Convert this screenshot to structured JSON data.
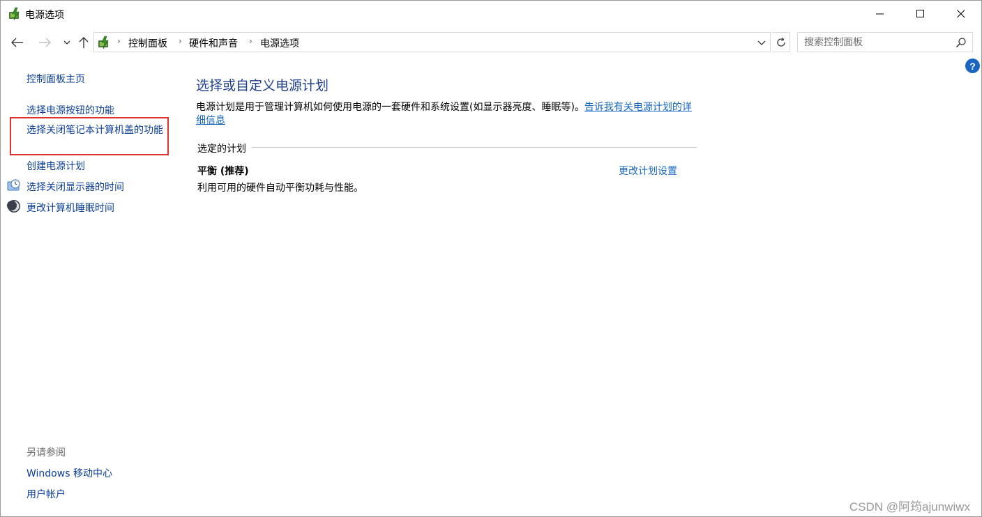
{
  "window": {
    "title": "电源选项",
    "icon": "power-options-icon"
  },
  "nav": {
    "breadcrumbs": [
      "控制面板",
      "硬件和声音",
      "电源选项"
    ],
    "search_placeholder": "搜索控制面板"
  },
  "help": {
    "label": "?"
  },
  "left_pane": {
    "home": "控制面板主页",
    "items": [
      "选择电源按钮的功能",
      "选择关闭笔记本计算机盖的功能",
      "创建电源计划",
      "选择关闭显示器的时间",
      "更改计算机睡眠时间"
    ],
    "see_also_label": "另请参阅",
    "see_also": [
      "Windows 移动中心",
      "用户帐户"
    ]
  },
  "main": {
    "title": "选择或自定义电源计划",
    "description": "电源计划是用于管理计算机如何使用电源的一套硬件和系统设置(如显示器亮度、睡眠等)。",
    "description_link": "告诉我有关电源计划的详细信息",
    "section_label": "选定的计划",
    "plan": {
      "name": "平衡 (推荐)",
      "change_link": "更改计划设置",
      "description": "利用可用的硬件自动平衡功耗与性能。"
    }
  },
  "watermark": "CSDN @阿筠ajunwiwx",
  "colors": {
    "link": "#0b3e96",
    "title": "#1e3f8a",
    "highlight_border": "#e03131",
    "help_icon": "#1a64c2"
  }
}
